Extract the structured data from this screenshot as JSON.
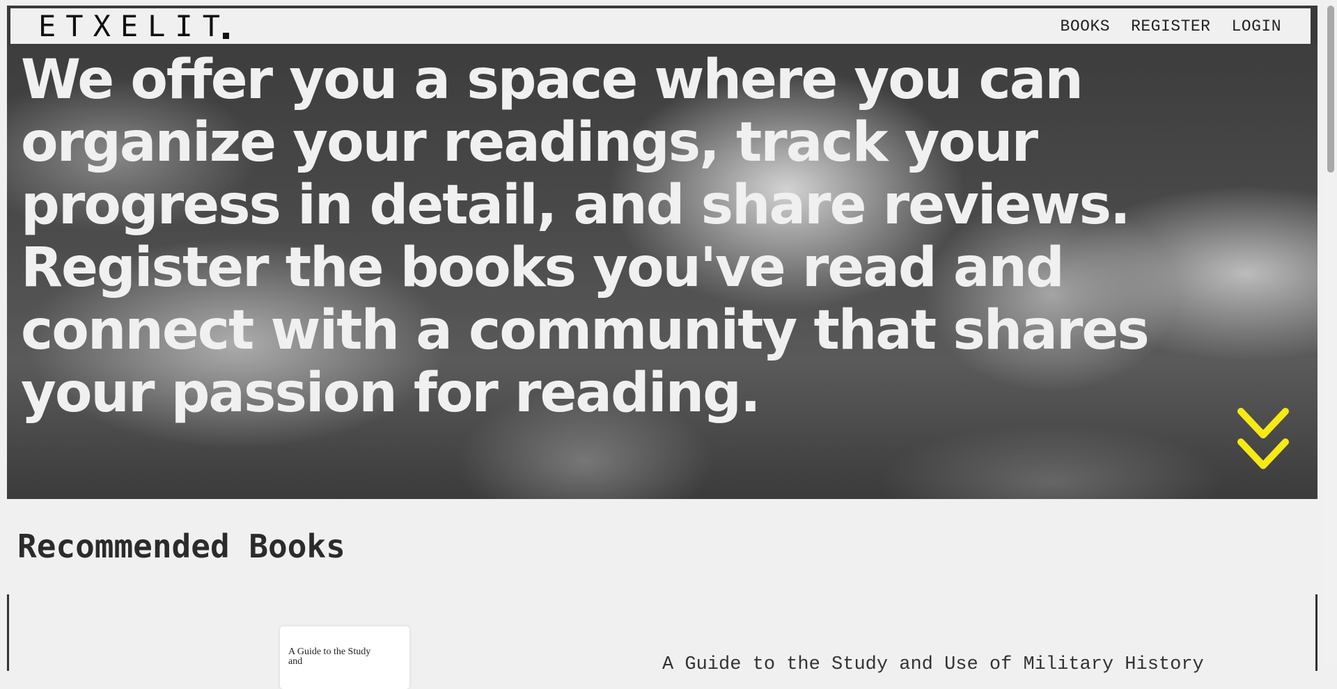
{
  "brand": {
    "logo": "ETXELIT"
  },
  "nav": {
    "books": "BOOKS",
    "register": "REGISTER",
    "login": "LOGIN"
  },
  "hero": {
    "text": "We offer you a space where you can organize your readings, track your progress in detail, and share reviews. Register the books you've read and connect with a community that shares your passion for reading.",
    "scroll_icon": "double-chevron-down-icon",
    "accent_color": "#f5ea14"
  },
  "recommended": {
    "title": "Recommended Books",
    "books": [
      {
        "cover_text": "A Guide to the Study and",
        "title": "A Guide to the Study and Use of Military History"
      }
    ]
  }
}
